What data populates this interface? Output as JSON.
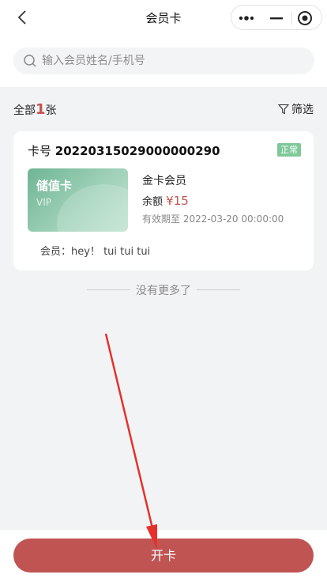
{
  "nav": {
    "title": "会员卡",
    "icons": [
      "back-icon",
      "more-dots-icon",
      "minimize-icon",
      "target-icon"
    ]
  },
  "search": {
    "placeholder": "输入会员姓名/手机号",
    "value": ""
  },
  "summary": {
    "prefix": "全部",
    "count": "1",
    "suffix": "张",
    "filter_label": "筛选"
  },
  "cards": [
    {
      "card_label": "卡号",
      "card_number": "20220315029000000290",
      "status": "正常",
      "card_type": "储值卡",
      "vip_tag": "VIP",
      "level": "金卡会员",
      "balance_label": "余额",
      "balance": "¥15",
      "expiry": "有效期至 2022-03-20 00:00:00",
      "member_note": "会员：hey！ tui tui tui"
    }
  ],
  "list_end": "没有更多了",
  "footer": {
    "open_card_label": "开卡"
  },
  "colors": {
    "accent": "#bf5453",
    "status_green": "#7fc89a",
    "card_green": "#8ec8aa"
  }
}
